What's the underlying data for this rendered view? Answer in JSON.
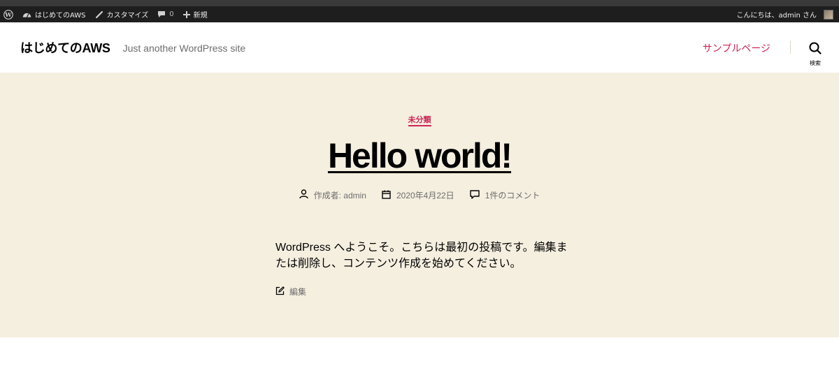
{
  "adminbar": {
    "wp_logo": "wordpress-icon",
    "site_name": "はじめてのAWS",
    "customize": "カスタマイズ",
    "comments_count": "0",
    "new_label": "新規",
    "greeting": "こんにちは、admin さん"
  },
  "header": {
    "site_title": "はじめてのAWS",
    "site_description": "Just another WordPress site",
    "menu_item": "サンプルページ",
    "search_label": "検索"
  },
  "post": {
    "category": "未分類",
    "title": "Hello world!",
    "author": "作成者: admin",
    "date": "2020年4月22日",
    "comments": "1件のコメント",
    "content": "WordPress へようこそ。こちらは最初の投稿です。編集または削除し、コンテンツ作成を始めてください。",
    "edit_label": "編集"
  },
  "colors": {
    "accent": "#cd2653",
    "hero_bg": "#f5efe0",
    "adminbar_bg": "#1e1e1e"
  }
}
